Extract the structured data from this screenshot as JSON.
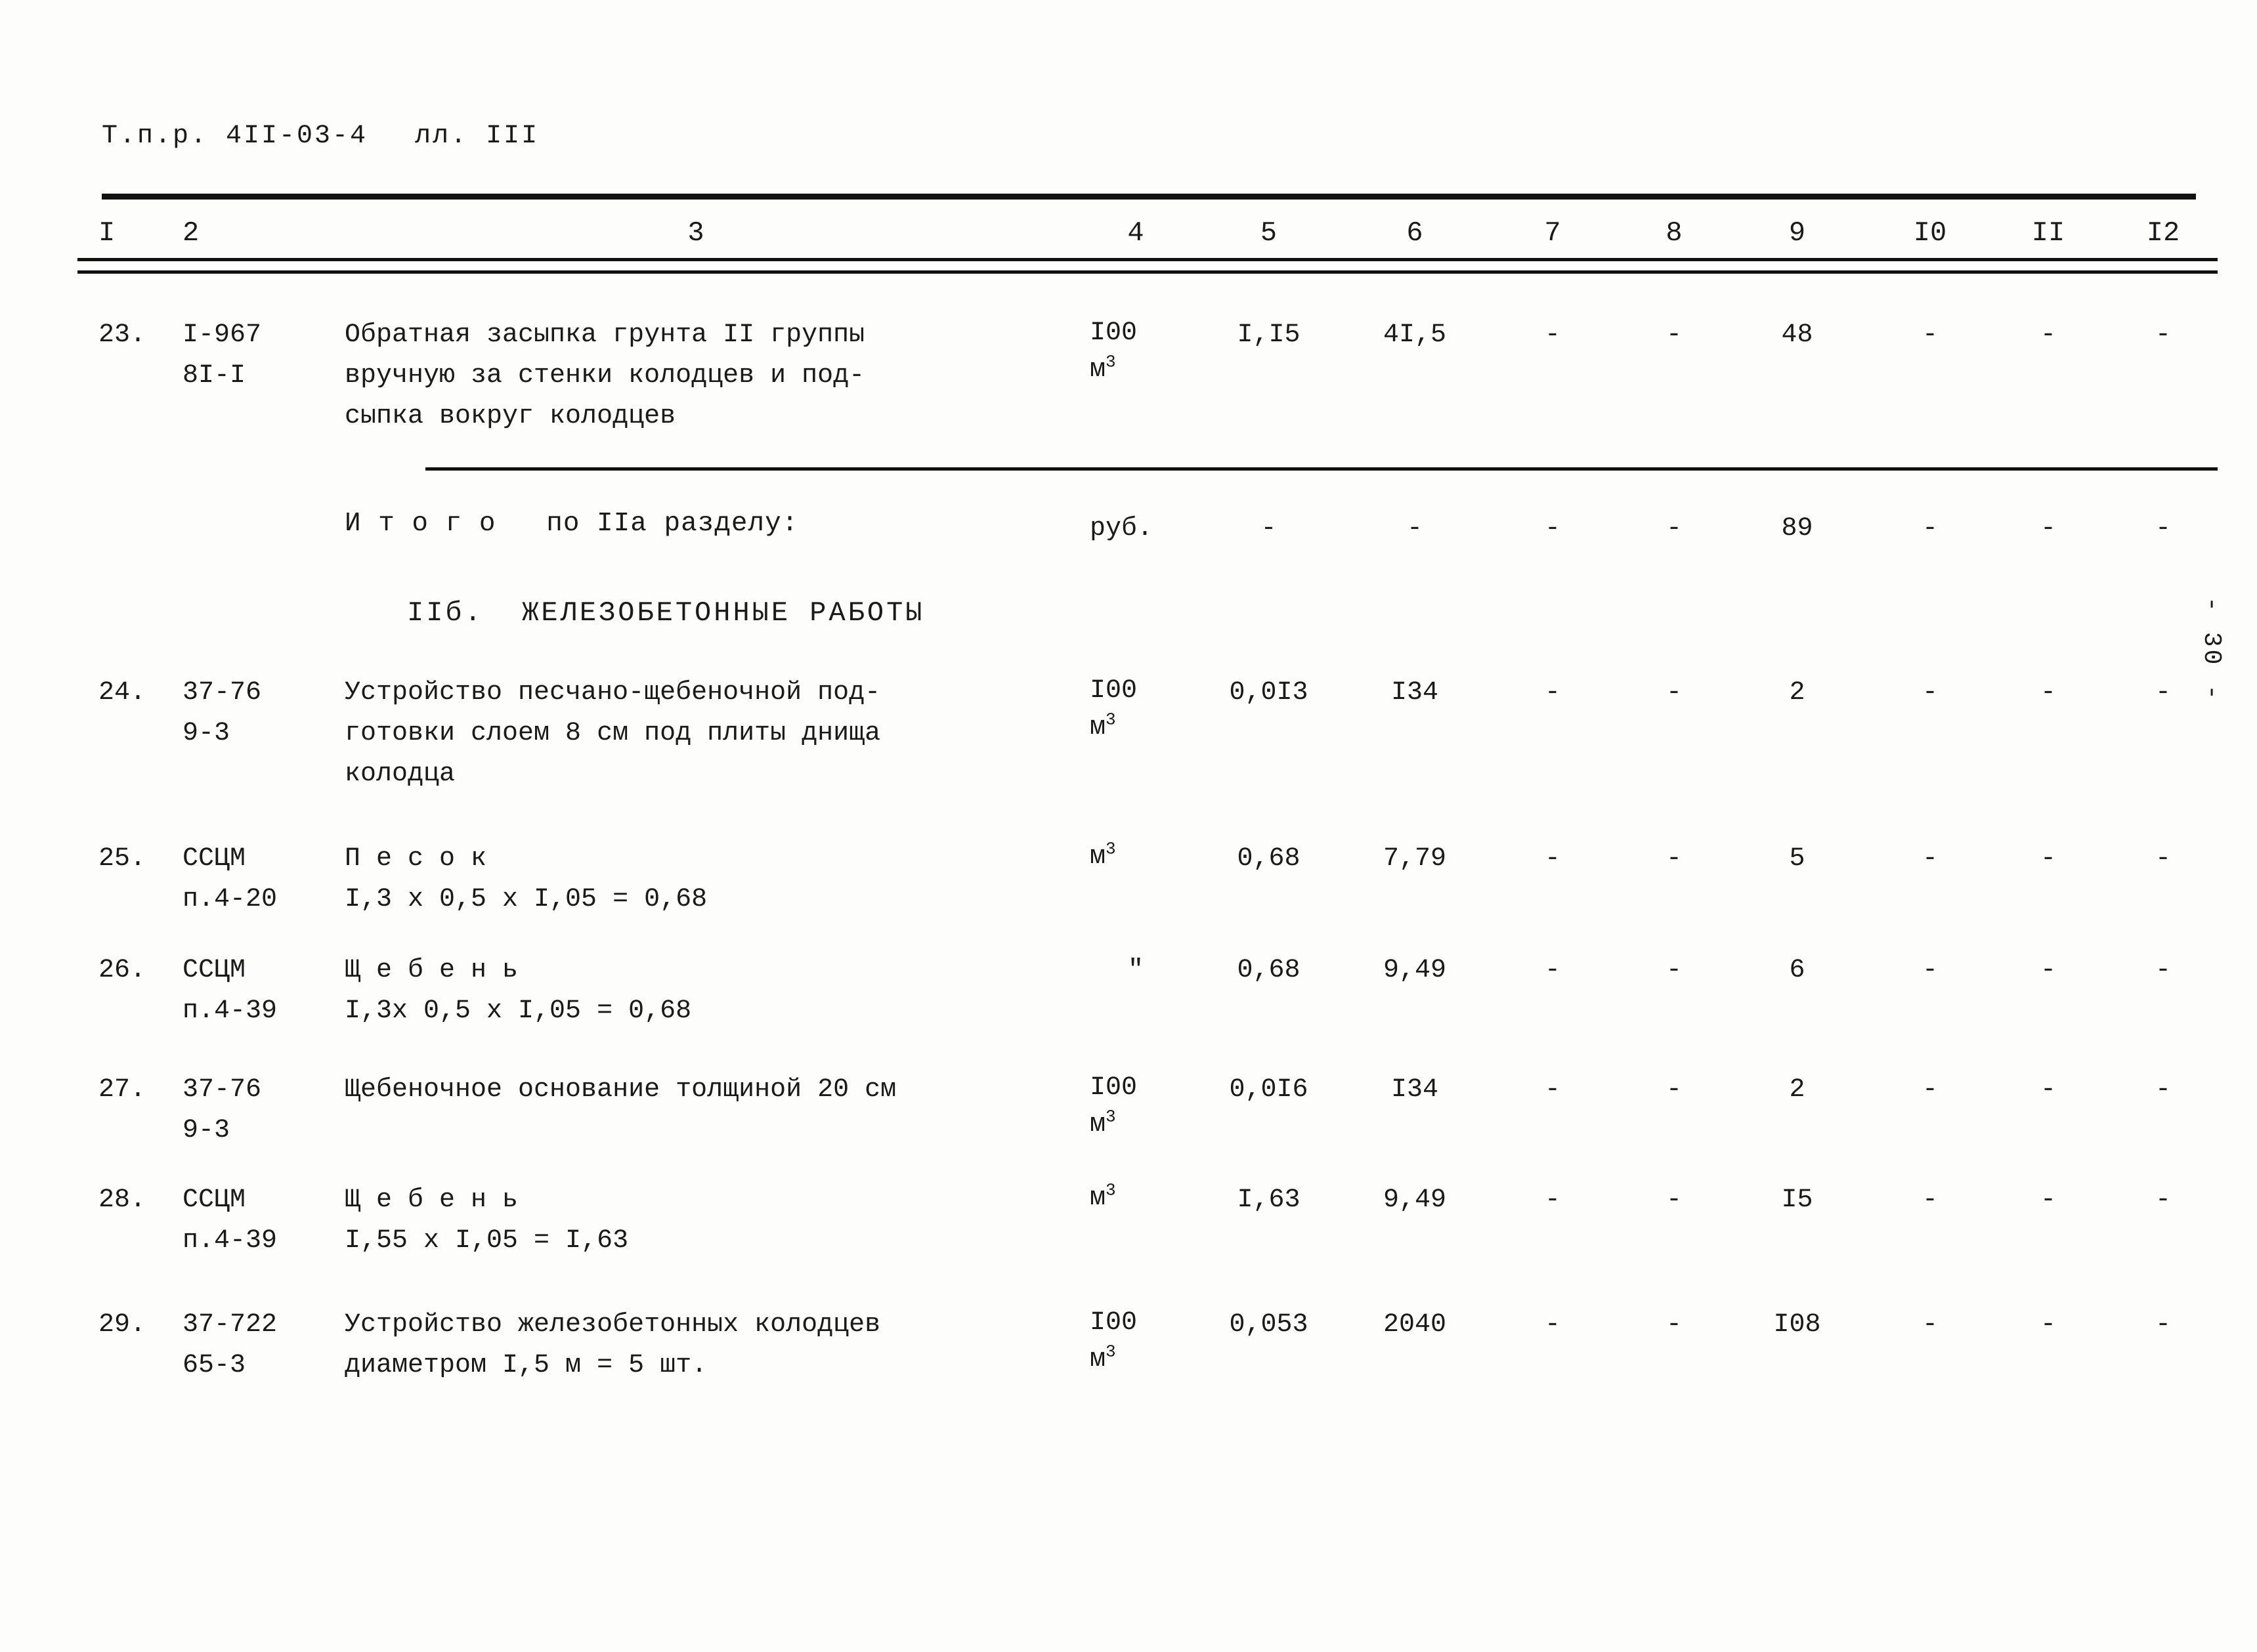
{
  "document": {
    "header_code": "Т.п.р. 4II-03-4",
    "header_sheet": "лл. III",
    "page_marker": "- 30 -"
  },
  "table": {
    "column_headers": [
      "I",
      "2",
      "3",
      "4",
      "5",
      "6",
      "7",
      "8",
      "9",
      "I0",
      "II",
      "I2"
    ],
    "rows": [
      {
        "num": "23.",
        "code_lines": [
          "I-967",
          "8I-I"
        ],
        "desc_lines": [
          "Обратная засыпка грунта II группы",
          "вручную за стенки колодцев и под-",
          "сыпка вокруг колодцев"
        ],
        "unit": "I00",
        "unit_sup": "м",
        "unit_sup_exp": "3",
        "c5": "I,I5",
        "c6": "4I,5",
        "c7": "-",
        "c8": "-",
        "c9": "48",
        "c10": "-",
        "c11": "-",
        "c12": "-"
      },
      {
        "num": "24.",
        "code_lines": [
          "37-76",
          "9-3"
        ],
        "desc_lines": [
          "Устройство песчано-щебеночной под-",
          "готовки слоем 8 см под плиты днища",
          "колодца"
        ],
        "unit": "I00",
        "unit_sup": "м",
        "unit_sup_exp": "3",
        "c5": "0,0I3",
        "c6": "I34",
        "c7": "-",
        "c8": "-",
        "c9": "2",
        "c10": "-",
        "c11": "-",
        "c12": "-"
      },
      {
        "num": "25.",
        "code_lines": [
          "ССЦМ",
          "п.4-20"
        ],
        "desc_lines": [
          "П е с о к",
          "I,3 х 0,5 х I,05 = 0,68"
        ],
        "unit": "м",
        "unit_sup": "",
        "unit_sup_exp": "3",
        "c5": "0,68",
        "c6": "7,79",
        "c7": "-",
        "c8": "-",
        "c9": "5",
        "c10": "-",
        "c11": "-",
        "c12": "-"
      },
      {
        "num": "26.",
        "code_lines": [
          "ССЦМ",
          "п.4-39"
        ],
        "desc_lines": [
          "Щ е б е н ь",
          "I,3х 0,5 х I,05 = 0,68"
        ],
        "unit": "\"",
        "unit_sup": "",
        "unit_sup_exp": "",
        "c5": "0,68",
        "c6": "9,49",
        "c7": "-",
        "c8": "-",
        "c9": "6",
        "c10": "-",
        "c11": "-",
        "c12": "-"
      },
      {
        "num": "27.",
        "code_lines": [
          "37-76",
          "9-3"
        ],
        "desc_lines": [
          "Щебеночное основание толщиной 20 см"
        ],
        "unit": "I00",
        "unit_sup": "м",
        "unit_sup_exp": "3",
        "c5": "0,0I6",
        "c6": "I34",
        "c7": "-",
        "c8": "-",
        "c9": "2",
        "c10": "-",
        "c11": "-",
        "c12": "-"
      },
      {
        "num": "28.",
        "code_lines": [
          "ССЦМ",
          "п.4-39"
        ],
        "desc_lines": [
          "Щ е б е н ь",
          "I,55 х I,05 = I,63"
        ],
        "unit": "м",
        "unit_sup": "",
        "unit_sup_exp": "3",
        "c5": "I,63",
        "c6": "9,49",
        "c7": "-",
        "c8": "-",
        "c9": "I5",
        "c10": "-",
        "c11": "-",
        "c12": "-"
      },
      {
        "num": "29.",
        "code_lines": [
          "37-722",
          "65-3"
        ],
        "desc_lines": [
          "Устройство железобетонных колодцев",
          "диаметром I,5 м = 5 шт."
        ],
        "unit": "I00",
        "unit_sup": "м",
        "unit_sup_exp": "3",
        "c5": "0,053",
        "c6": "2040",
        "c7": "-",
        "c8": "-",
        "c9": "I08",
        "c10": "-",
        "c11": "-",
        "c12": "-"
      }
    ],
    "total_row": {
      "label": "И т о г о   по IIа разделу:",
      "unit": "руб.",
      "c5": "-",
      "c6": "-",
      "c7": "-",
      "c8": "-",
      "c9": "89",
      "c10": "-",
      "c11": "-",
      "c12": "-"
    },
    "section_heading": "IIб.  ЖЕЛЕЗОБЕТОННЫЕ РАБОТЫ"
  }
}
